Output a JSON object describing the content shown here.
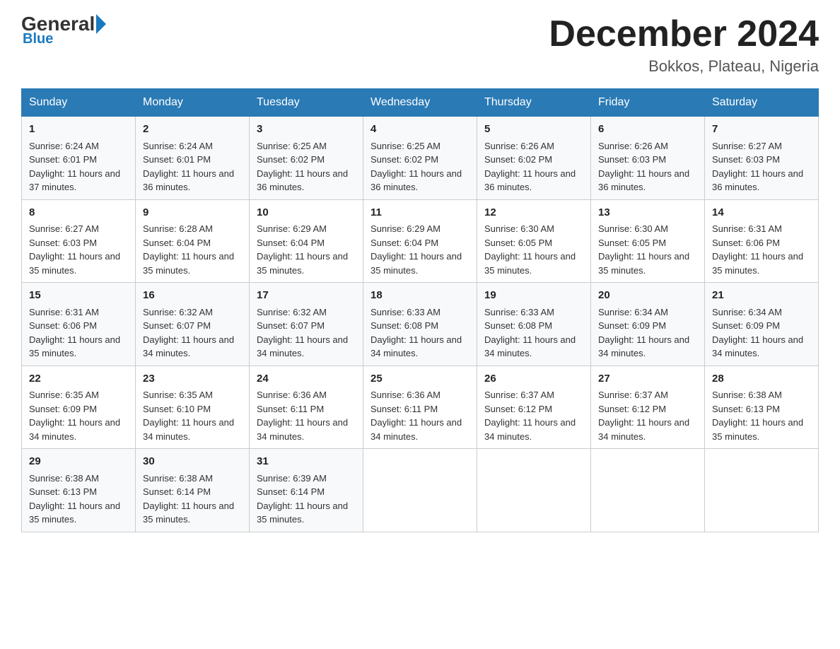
{
  "logo": {
    "general": "General",
    "blue": "Blue",
    "arrow": "▶"
  },
  "title": "December 2024",
  "location": "Bokkos, Plateau, Nigeria",
  "days_of_week": [
    "Sunday",
    "Monday",
    "Tuesday",
    "Wednesday",
    "Thursday",
    "Friday",
    "Saturday"
  ],
  "weeks": [
    [
      {
        "day": "1",
        "sunrise": "6:24 AM",
        "sunset": "6:01 PM",
        "daylight": "11 hours and 37 minutes."
      },
      {
        "day": "2",
        "sunrise": "6:24 AM",
        "sunset": "6:01 PM",
        "daylight": "11 hours and 36 minutes."
      },
      {
        "day": "3",
        "sunrise": "6:25 AM",
        "sunset": "6:02 PM",
        "daylight": "11 hours and 36 minutes."
      },
      {
        "day": "4",
        "sunrise": "6:25 AM",
        "sunset": "6:02 PM",
        "daylight": "11 hours and 36 minutes."
      },
      {
        "day": "5",
        "sunrise": "6:26 AM",
        "sunset": "6:02 PM",
        "daylight": "11 hours and 36 minutes."
      },
      {
        "day": "6",
        "sunrise": "6:26 AM",
        "sunset": "6:03 PM",
        "daylight": "11 hours and 36 minutes."
      },
      {
        "day": "7",
        "sunrise": "6:27 AM",
        "sunset": "6:03 PM",
        "daylight": "11 hours and 36 minutes."
      }
    ],
    [
      {
        "day": "8",
        "sunrise": "6:27 AM",
        "sunset": "6:03 PM",
        "daylight": "11 hours and 35 minutes."
      },
      {
        "day": "9",
        "sunrise": "6:28 AM",
        "sunset": "6:04 PM",
        "daylight": "11 hours and 35 minutes."
      },
      {
        "day": "10",
        "sunrise": "6:29 AM",
        "sunset": "6:04 PM",
        "daylight": "11 hours and 35 minutes."
      },
      {
        "day": "11",
        "sunrise": "6:29 AM",
        "sunset": "6:04 PM",
        "daylight": "11 hours and 35 minutes."
      },
      {
        "day": "12",
        "sunrise": "6:30 AM",
        "sunset": "6:05 PM",
        "daylight": "11 hours and 35 minutes."
      },
      {
        "day": "13",
        "sunrise": "6:30 AM",
        "sunset": "6:05 PM",
        "daylight": "11 hours and 35 minutes."
      },
      {
        "day": "14",
        "sunrise": "6:31 AM",
        "sunset": "6:06 PM",
        "daylight": "11 hours and 35 minutes."
      }
    ],
    [
      {
        "day": "15",
        "sunrise": "6:31 AM",
        "sunset": "6:06 PM",
        "daylight": "11 hours and 35 minutes."
      },
      {
        "day": "16",
        "sunrise": "6:32 AM",
        "sunset": "6:07 PM",
        "daylight": "11 hours and 34 minutes."
      },
      {
        "day": "17",
        "sunrise": "6:32 AM",
        "sunset": "6:07 PM",
        "daylight": "11 hours and 34 minutes."
      },
      {
        "day": "18",
        "sunrise": "6:33 AM",
        "sunset": "6:08 PM",
        "daylight": "11 hours and 34 minutes."
      },
      {
        "day": "19",
        "sunrise": "6:33 AM",
        "sunset": "6:08 PM",
        "daylight": "11 hours and 34 minutes."
      },
      {
        "day": "20",
        "sunrise": "6:34 AM",
        "sunset": "6:09 PM",
        "daylight": "11 hours and 34 minutes."
      },
      {
        "day": "21",
        "sunrise": "6:34 AM",
        "sunset": "6:09 PM",
        "daylight": "11 hours and 34 minutes."
      }
    ],
    [
      {
        "day": "22",
        "sunrise": "6:35 AM",
        "sunset": "6:09 PM",
        "daylight": "11 hours and 34 minutes."
      },
      {
        "day": "23",
        "sunrise": "6:35 AM",
        "sunset": "6:10 PM",
        "daylight": "11 hours and 34 minutes."
      },
      {
        "day": "24",
        "sunrise": "6:36 AM",
        "sunset": "6:11 PM",
        "daylight": "11 hours and 34 minutes."
      },
      {
        "day": "25",
        "sunrise": "6:36 AM",
        "sunset": "6:11 PM",
        "daylight": "11 hours and 34 minutes."
      },
      {
        "day": "26",
        "sunrise": "6:37 AM",
        "sunset": "6:12 PM",
        "daylight": "11 hours and 34 minutes."
      },
      {
        "day": "27",
        "sunrise": "6:37 AM",
        "sunset": "6:12 PM",
        "daylight": "11 hours and 34 minutes."
      },
      {
        "day": "28",
        "sunrise": "6:38 AM",
        "sunset": "6:13 PM",
        "daylight": "11 hours and 35 minutes."
      }
    ],
    [
      {
        "day": "29",
        "sunrise": "6:38 AM",
        "sunset": "6:13 PM",
        "daylight": "11 hours and 35 minutes."
      },
      {
        "day": "30",
        "sunrise": "6:38 AM",
        "sunset": "6:14 PM",
        "daylight": "11 hours and 35 minutes."
      },
      {
        "day": "31",
        "sunrise": "6:39 AM",
        "sunset": "6:14 PM",
        "daylight": "11 hours and 35 minutes."
      },
      null,
      null,
      null,
      null
    ]
  ]
}
